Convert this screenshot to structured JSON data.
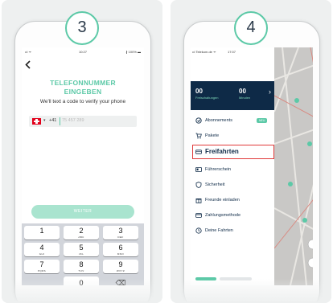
{
  "colors": {
    "accent": "#5cc9a7",
    "navy": "#0e2a47",
    "highlight": "#e03a3a",
    "flag_red": "#e2001a"
  },
  "left": {
    "step": "3",
    "status": {
      "signal": "•ıl ᯤ",
      "time": "10:27",
      "battery": "∦ 100% ▬"
    },
    "back_icon": "chevron-left-icon",
    "title_line1": "TELEFONNUMMER",
    "title_line2": "EINGEBEN",
    "subtitle": "We'll text a code to verify your phone",
    "phone_input": {
      "country": "Switzerland",
      "flag_icon": "swiss-flag-icon",
      "dropdown": "▾",
      "code": "+41",
      "placeholder": "75 457 289"
    },
    "button": "WEITER",
    "keys": [
      {
        "n": "1",
        "l": ""
      },
      {
        "n": "2",
        "l": "ABC"
      },
      {
        "n": "3",
        "l": "DEF"
      },
      {
        "n": "4",
        "l": "GHI"
      },
      {
        "n": "5",
        "l": "JKL"
      },
      {
        "n": "6",
        "l": "MNO"
      },
      {
        "n": "7",
        "l": "PQRS"
      },
      {
        "n": "8",
        "l": "TUV"
      },
      {
        "n": "9",
        "l": "WXYZ"
      },
      {
        "n": "0",
        "l": ""
      }
    ],
    "delete_icon": "⌫"
  },
  "right": {
    "step": "4",
    "status": {
      "carrier": "•ıl Telekom.de ᯤ",
      "time": "17:07",
      "extra": "ıl ◈ ◈ ▬"
    },
    "stats": [
      {
        "value": "00",
        "label": "Freischaltungen"
      },
      {
        "value": "00",
        "label": "Minuten"
      }
    ],
    "chevron": "›",
    "menu": [
      {
        "label": "Abonnements",
        "icon": "subscription-icon",
        "badge": "NEU"
      },
      {
        "label": "Pakete",
        "icon": "cart-icon"
      },
      {
        "label": "Freifahrten",
        "icon": "ticket-icon"
      },
      {
        "label": "Führerschein",
        "icon": "license-icon"
      },
      {
        "label": "Sicherheit",
        "icon": "shield-icon"
      },
      {
        "label": "Freunde einladen",
        "icon": "gift-icon"
      },
      {
        "label": "Zahlungsmethode",
        "icon": "card-icon"
      },
      {
        "label": "Deine Fahrten",
        "icon": "clock-icon"
      }
    ]
  }
}
